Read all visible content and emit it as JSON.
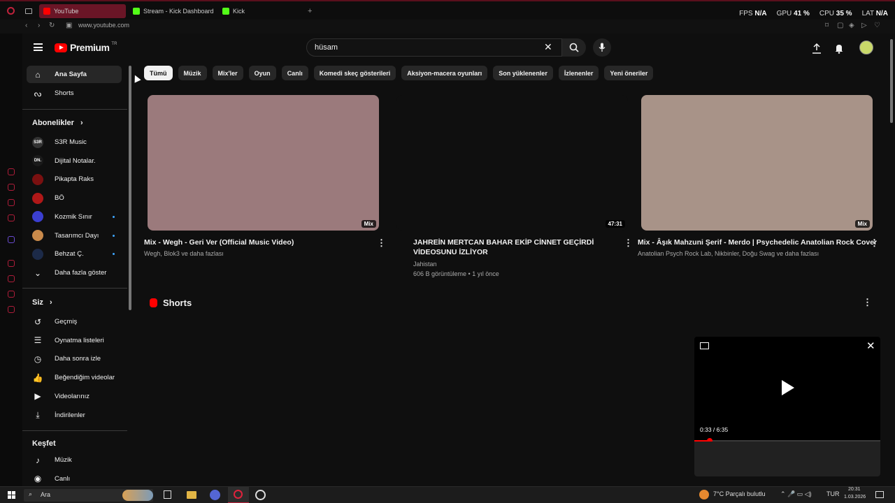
{
  "browser": {
    "tabs": [
      {
        "label": "YouTube",
        "color": "#ff0000",
        "active": true
      },
      {
        "label": "Stream - Kick Dashboard",
        "color": "#53fc18"
      },
      {
        "label": "Kick",
        "color": "#53fc18"
      }
    ],
    "new_tab": "+",
    "url": "www.youtube.com",
    "stats": {
      "fps_label": "FPS",
      "fps": "N/A",
      "gpu_label": "GPU",
      "gpu": "41 %",
      "cpu_label": "CPU",
      "cpu": "35 %",
      "lat_label": "LAT",
      "lat": "N/A"
    }
  },
  "youtube": {
    "logo_text": "Premium",
    "logo_region": "TR",
    "search_value": "hüsam",
    "chips": [
      "Tümü",
      "Müzik",
      "Mix'ler",
      "Oyun",
      "Canlı",
      "Komedi skeç gösterileri",
      "Aksiyon-macera oyunları",
      "Son yüklenenler",
      "İzlenenler",
      "Yeni öneriler"
    ],
    "sidebar": {
      "main": [
        {
          "label": "Ana Sayfa",
          "icon": "home-icon"
        },
        {
          "label": "Shorts",
          "icon": "shorts-icon"
        }
      ],
      "subs_header": "Abonelikler",
      "subs": [
        {
          "label": "S3R Music",
          "avatar": "S3R",
          "color": "#333333"
        },
        {
          "label": "Dijital Notalar.",
          "avatar": "DN.",
          "color": "#1a1a1a"
        },
        {
          "label": "Pikapta Raks",
          "avatar": "",
          "color": "#7a1010"
        },
        {
          "label": "BÖ",
          "avatar": "",
          "color": "#b01818"
        },
        {
          "label": "Kozmik Sınır",
          "avatar": "",
          "color": "#3b3fd1"
        },
        {
          "label": "Tasarımcı Dayı",
          "avatar": "",
          "color": "#c98a4b"
        },
        {
          "label": "Behzat Ç.",
          "avatar": "",
          "color": "#1c2a48"
        }
      ],
      "more": "Daha fazla göster",
      "you_header": "Siz",
      "you": [
        {
          "label": "Geçmiş",
          "icon": "history-icon"
        },
        {
          "label": "Oynatma listeleri",
          "icon": "playlist-icon"
        },
        {
          "label": "Daha sonra izle",
          "icon": "clock-icon"
        },
        {
          "label": "Beğendiğim videolar",
          "icon": "like-icon"
        },
        {
          "label": "Videolarınız",
          "icon": "video-icon"
        },
        {
          "label": "İndirilenler",
          "icon": "download-icon"
        }
      ],
      "explore_header": "Keşfet",
      "explore": [
        {
          "label": "Müzik",
          "icon": "music-icon"
        },
        {
          "label": "Canlı",
          "icon": "live-icon"
        }
      ]
    },
    "videos": [
      {
        "title": "Mix - Wegh - Geri Ver (Official Music Video)",
        "meta": "Wegh, Blok3 ve daha fazlası",
        "stats": "",
        "badge": "Mix",
        "thumb_color": "#9b7a7c"
      },
      {
        "title": "JAHREİN MERTCAN BAHAR EKİP CİNNET GEÇİRDİ VİDEOSUNU İZLİYOR",
        "meta": "Jahistan",
        "stats": "606 B görüntüleme • 1 yıl önce",
        "badge": "47:31",
        "thumb_color": "#0f0f0f"
      },
      {
        "title": "Mix - Âşık Mahzuni Şerif - Merdo | Psychedelic Anatolian Rock Cover",
        "meta": "Anatolian Psych Rock Lab, Nikbinler, Doğu Swag ve daha fazlası",
        "stats": "",
        "badge": "Mix",
        "thumb_color": "#a89388"
      }
    ],
    "shorts_title": "Shorts",
    "miniplayer": {
      "time": "0:33 / 6:35",
      "progress": 0.084
    }
  },
  "taskbar": {
    "search": "Ara",
    "weather": "7°C  Parçalı bulutlu",
    "lang": "TUR",
    "time": "20:31",
    "date": "1.03.2026"
  }
}
